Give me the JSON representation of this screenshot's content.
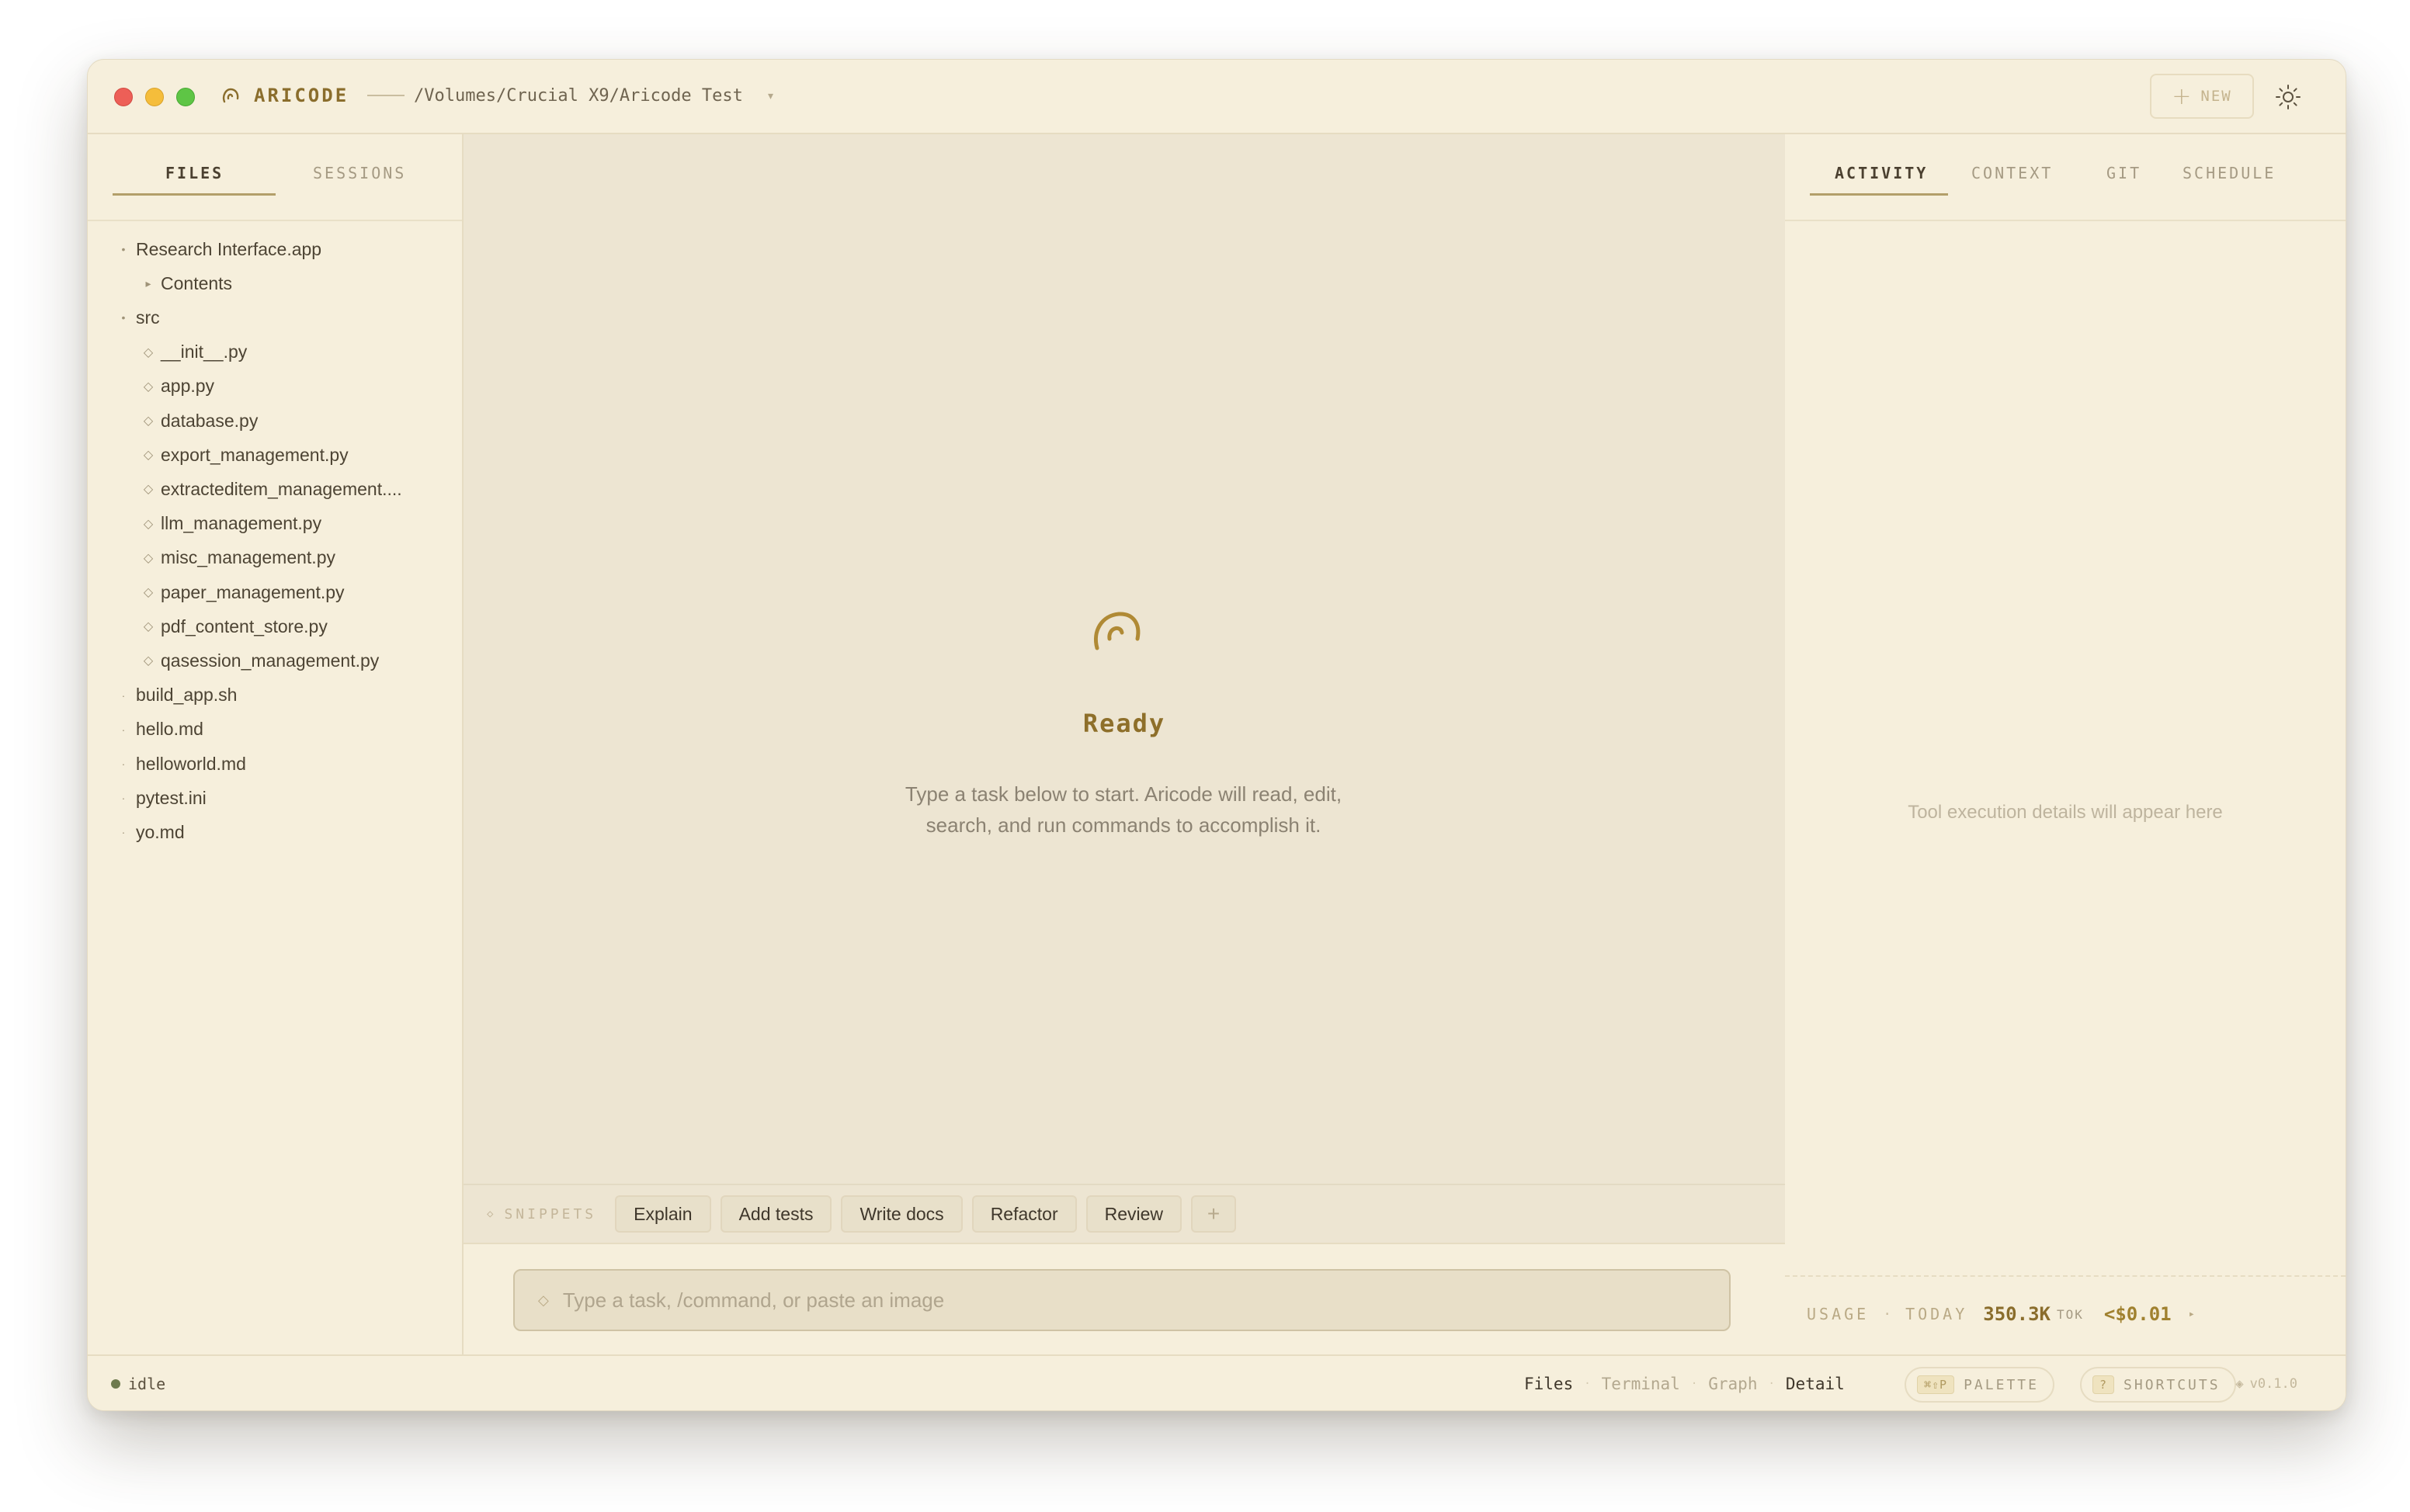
{
  "app": {
    "name": "ARICODE",
    "path": "/Volumes/Crucial X9/Aricode Test",
    "new_label": "NEW"
  },
  "left_tabs": [
    "FILES",
    "SESSIONS"
  ],
  "files": [
    {
      "label": "Research Interface.app",
      "marker": "•",
      "depth": 0
    },
    {
      "label": "Contents",
      "marker": "▸",
      "depth": 1
    },
    {
      "label": "src",
      "marker": "•",
      "depth": 0
    },
    {
      "label": "__init__.py",
      "marker": "◇",
      "depth": 1
    },
    {
      "label": "app.py",
      "marker": "◇",
      "depth": 1
    },
    {
      "label": "database.py",
      "marker": "◇",
      "depth": 1
    },
    {
      "label": "export_management.py",
      "marker": "◇",
      "depth": 1
    },
    {
      "label": "extracteditem_management....",
      "marker": "◇",
      "depth": 1
    },
    {
      "label": "llm_management.py",
      "marker": "◇",
      "depth": 1
    },
    {
      "label": "misc_management.py",
      "marker": "◇",
      "depth": 1
    },
    {
      "label": "paper_management.py",
      "marker": "◇",
      "depth": 1
    },
    {
      "label": "pdf_content_store.py",
      "marker": "◇",
      "depth": 1
    },
    {
      "label": "qasession_management.py",
      "marker": "◇",
      "depth": 1
    },
    {
      "label": "build_app.sh",
      "marker": "·",
      "depth": 0
    },
    {
      "label": "hello.md",
      "marker": "·",
      "depth": 0
    },
    {
      "label": "helloworld.md",
      "marker": "·",
      "depth": 0
    },
    {
      "label": "pytest.ini",
      "marker": "·",
      "depth": 0
    },
    {
      "label": "yo.md",
      "marker": "·",
      "depth": 0
    }
  ],
  "center": {
    "title": "Ready",
    "subtitle_line1": "Type a task below to start. Aricode will read, edit,",
    "subtitle_line2": "search, and run commands to accomplish it."
  },
  "snippets": {
    "label": "SNIPPETS",
    "items": [
      "Explain",
      "Add tests",
      "Write docs",
      "Refactor",
      "Review"
    ],
    "add_label": "+"
  },
  "input": {
    "placeholder": "Type a task, /command, or paste an image"
  },
  "right_tabs": [
    "ACTIVITY",
    "CONTEXT",
    "GIT",
    "SCHEDULE"
  ],
  "activity": {
    "placeholder": "Tool execution details will appear here"
  },
  "usage": {
    "label": "USAGE",
    "period": "TODAY",
    "tokens": "350.3K",
    "tokens_unit": "TOK",
    "cost": "<$0.01"
  },
  "status": {
    "state": "idle",
    "views": [
      "Files",
      "Terminal",
      "Graph",
      "Detail"
    ],
    "palette_key": "⌘⇧P",
    "palette_label": "PALETTE",
    "shortcuts_key": "?",
    "shortcuts_label": "SHORTCUTS",
    "version": "v0.1.0"
  },
  "colors": {
    "accent": "#8a6d2c",
    "background": "#f6efdc",
    "center_bg": "#ede5d2"
  }
}
